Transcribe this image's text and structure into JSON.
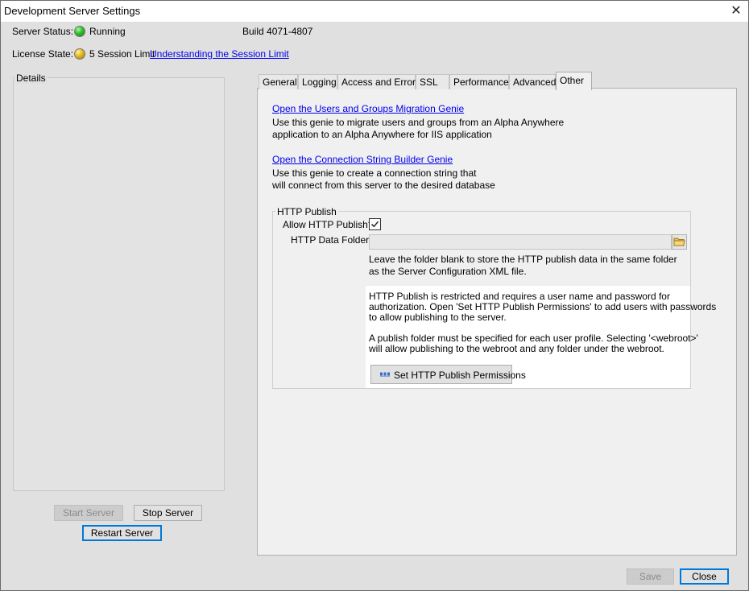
{
  "window": {
    "title": "Development Server Settings"
  },
  "status": {
    "server_label": "Server Status:",
    "server_value": "Running",
    "build": "Build 4071-4807",
    "license_label": "License State:",
    "license_value": "5 Session Limit",
    "license_link": "Understanding the Session Limit",
    "colors": {
      "running": "#2fbe2c",
      "license": "#e2b820"
    }
  },
  "details": {
    "label": "Details"
  },
  "server_buttons": {
    "start": "Start Server",
    "stop": "Stop Server",
    "restart": "Restart Server"
  },
  "tabs": [
    {
      "label": "General"
    },
    {
      "label": "Logging"
    },
    {
      "label": "Access and Errors"
    },
    {
      "label": "SSL"
    },
    {
      "label": "Performance"
    },
    {
      "label": "Advanced"
    },
    {
      "label": "Other"
    }
  ],
  "other_tab": {
    "migration_link": "Open the Users and Groups Migration Genie",
    "migration_desc_1": "Use this genie to migrate users and groups from an Alpha Anywhere",
    "migration_desc_2": "application to an Alpha Anywhere for IIS application",
    "connection_link": "Open the Connection String Builder Genie",
    "connection_desc_1": "Use this genie to create a connection string that",
    "connection_desc_2": "will connect from this server to the desired database",
    "http_publish": {
      "group_label": "HTTP Publish",
      "allow_label": "Allow HTTP Publish?",
      "allow_checked": true,
      "folder_label": "HTTP Data Folder",
      "folder_value": "",
      "folder_note_1": "Leave the folder blank to store the HTTP publish data in the same folder",
      "folder_note_2": "as the Server Configuration XML file.",
      "info_1": "HTTP Publish is restricted and requires a user name and password for",
      "info_2": "authorization. Open 'Set HTTP Publish Permissions' to add users with passwords",
      "info_3": "to allow publishing to the server.",
      "info_4": "A publish folder must be specified for each user profile.  Selecting '<webroot>'",
      "info_5": "will allow publishing to the webroot and any folder under the webroot.",
      "permissions_button": "Set HTTP Publish Permissions"
    }
  },
  "footer": {
    "save": "Save",
    "close": "Close"
  }
}
